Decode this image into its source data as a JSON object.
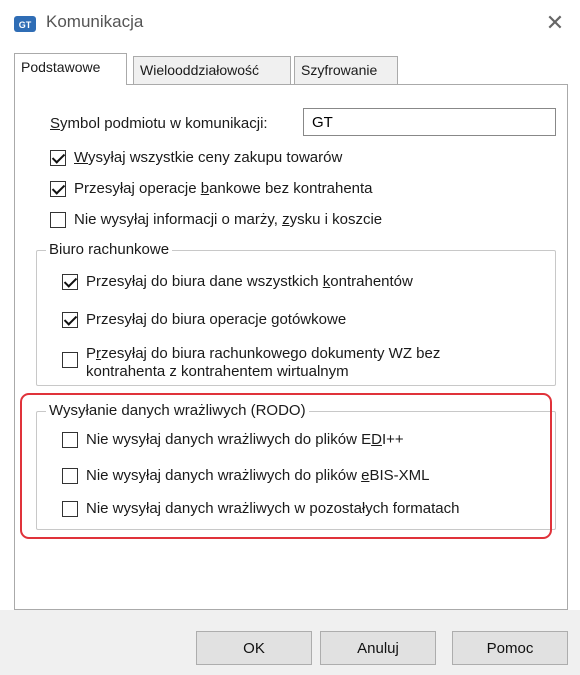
{
  "window": {
    "title": "Komunikacja",
    "close_glyph": "✕"
  },
  "tabs": [
    {
      "label": "Podstawowe",
      "active": true
    },
    {
      "label": "Wielooddziałowość",
      "active": false
    },
    {
      "label": "Szyfrowanie",
      "active": false
    }
  ],
  "symbol": {
    "label_first": "S",
    "label_rest": "ymbol podmiotu w komunikacji:",
    "value": "GT"
  },
  "options": [
    {
      "checked": true,
      "pre": "",
      "u": "W",
      "post": "ysyłaj wszystkie ceny zakupu towarów"
    },
    {
      "checked": true,
      "pre": "Przesyłaj operacje ",
      "u": "b",
      "post": "ankowe bez kontrahenta"
    },
    {
      "checked": false,
      "pre": "Nie wysyłaj informacji o marży, ",
      "u": "z",
      "post": "ysku i koszcie"
    }
  ],
  "biuro": {
    "title": "Biuro rachunkowe",
    "items": [
      {
        "checked": true,
        "pre": "Przesyłaj do biura dane wszystkich ",
        "u": "k",
        "post": "ontrahentów"
      },
      {
        "checked": true,
        "pre": "Przesyłaj do biura operacje ",
        "u": "g",
        "post": "otówkowe"
      },
      {
        "checked": false,
        "pre": "P",
        "u": "r",
        "post": "zesyłaj do biura rachunkowego dokumenty WZ bez",
        "line2": "kontrahenta z kontrahentem wirtualnym"
      }
    ]
  },
  "rodo": {
    "title": "Wysyłanie danych wrażliwych (RODO)",
    "items": [
      {
        "checked": false,
        "pre": "Nie wysyłaj danych wrażliwych do plików E",
        "u": "D",
        "post": "I++"
      },
      {
        "checked": false,
        "pre": "Nie wysyłaj danych wrażliwych do plików ",
        "u": "e",
        "post": "BIS-XML"
      },
      {
        "checked": false,
        "pre": "Nie wysyłaj danych wrażliwych w pozostałych formatach",
        "u": "",
        "post": ""
      }
    ]
  },
  "buttons": {
    "ok": "OK",
    "cancel": "Anuluj",
    "help": "Pomoc"
  },
  "colors": {
    "highlight": "#e0323a",
    "footer": "#f0f0f0",
    "button": "#e1e1e1"
  }
}
